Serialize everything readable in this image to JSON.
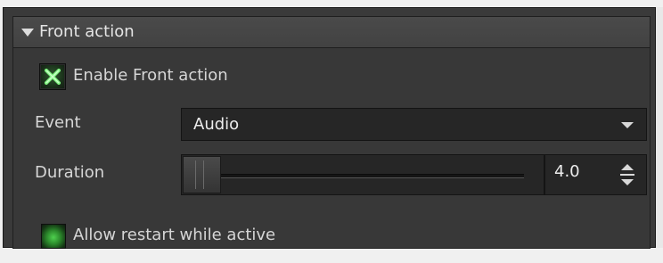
{
  "section": {
    "title": "Front action",
    "expanded": true
  },
  "enable_checkbox": {
    "label": "Enable Front action",
    "checked": true,
    "icon": "x-check-icon"
  },
  "event": {
    "label": "Event",
    "value": "Audio"
  },
  "duration": {
    "label": "Duration",
    "value": "4.0"
  },
  "allow_restart": {
    "label": "Allow restart while active",
    "checked": true
  },
  "colors": {
    "background": "#383838",
    "field": "#262626",
    "accent_green": "#4fd04f",
    "text": "#d6d6d6"
  }
}
